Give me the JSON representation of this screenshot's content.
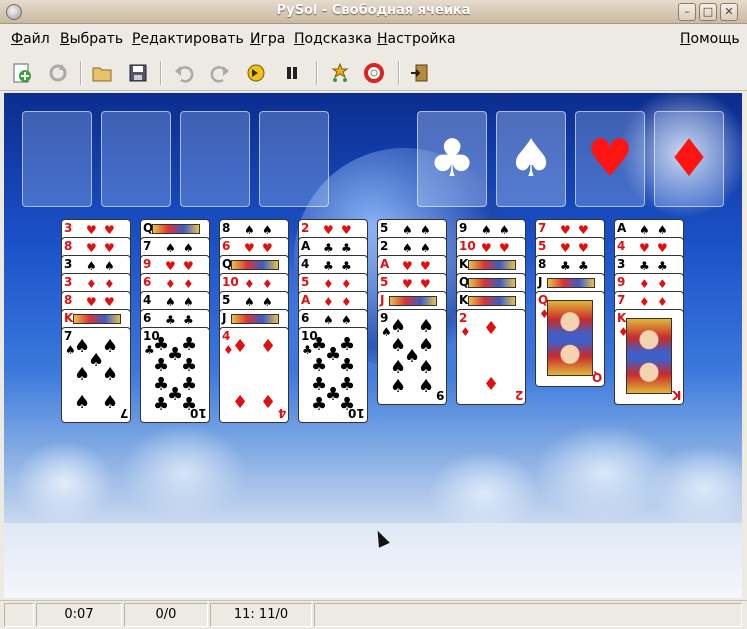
{
  "window": {
    "title": "PySol - Свободная ячейка"
  },
  "menu": [
    {
      "first": "Ф",
      "rest": "айл"
    },
    {
      "first": "В",
      "rest": "ыбрать"
    },
    {
      "first": "Р",
      "rest": "едактировать"
    },
    {
      "first": "И",
      "rest": "гра"
    },
    {
      "first": "П",
      "rest": "одсказка"
    },
    {
      "first": "Н",
      "rest": "астройка"
    }
  ],
  "help_menu": {
    "first": "П",
    "rest": "омощь"
  },
  "toolbar_icons": [
    "new-game-icon",
    "restart-icon",
    "open-icon",
    "save-icon",
    "undo-icon",
    "redo-icon",
    "autodrop-icon",
    "pause-icon",
    "statistics-icon",
    "rules-icon",
    "quit-icon"
  ],
  "status": {
    "time": "0:07",
    "moves": "0/0",
    "cards": "11: 11/0",
    "message": ""
  },
  "game": {
    "free_cells": 4,
    "foundations": [
      {
        "suit": "♣",
        "color": "white"
      },
      {
        "suit": "♠",
        "color": "white"
      },
      {
        "suit": "♥",
        "color": "red"
      },
      {
        "suit": "♦",
        "color": "red"
      }
    ],
    "tableau": [
      [
        {
          "r": "3",
          "s": "♥"
        },
        {
          "r": "8",
          "s": "♥"
        },
        {
          "r": "3",
          "s": "♠"
        },
        {
          "r": "3",
          "s": "♦"
        },
        {
          "r": "8",
          "s": "♥"
        },
        {
          "r": "K",
          "s": "♥"
        },
        {
          "r": "7",
          "s": "♠"
        }
      ],
      [
        {
          "r": "Q",
          "s": "♠"
        },
        {
          "r": "7",
          "s": "♠"
        },
        {
          "r": "9",
          "s": "♥"
        },
        {
          "r": "6",
          "s": "♦"
        },
        {
          "r": "4",
          "s": "♠"
        },
        {
          "r": "6",
          "s": "♣"
        },
        {
          "r": "10",
          "s": "♣"
        }
      ],
      [
        {
          "r": "8",
          "s": "♠"
        },
        {
          "r": "6",
          "s": "♥"
        },
        {
          "r": "Q",
          "s": "♣"
        },
        {
          "r": "10",
          "s": "♦"
        },
        {
          "r": "5",
          "s": "♠"
        },
        {
          "r": "J",
          "s": "♣"
        },
        {
          "r": "4",
          "s": "♦"
        }
      ],
      [
        {
          "r": "2",
          "s": "♥"
        },
        {
          "r": "A",
          "s": "♣"
        },
        {
          "r": "4",
          "s": "♣"
        },
        {
          "r": "5",
          "s": "♦"
        },
        {
          "r": "A",
          "s": "♦"
        },
        {
          "r": "6",
          "s": "♠"
        },
        {
          "r": "10",
          "s": "♣"
        }
      ],
      [
        {
          "r": "5",
          "s": "♠"
        },
        {
          "r": "2",
          "s": "♠"
        },
        {
          "r": "A",
          "s": "♥"
        },
        {
          "r": "5",
          "s": "♥"
        },
        {
          "r": "J",
          "s": "♦"
        },
        {
          "r": "9",
          "s": "♠"
        }
      ],
      [
        {
          "r": "9",
          "s": "♠"
        },
        {
          "r": "10",
          "s": "♥"
        },
        {
          "r": "K",
          "s": "♣"
        },
        {
          "r": "Q",
          "s": "♣"
        },
        {
          "r": "K",
          "s": "♠"
        },
        {
          "r": "2",
          "s": "♦"
        }
      ],
      [
        {
          "r": "7",
          "s": "♥"
        },
        {
          "r": "5",
          "s": "♥"
        },
        {
          "r": "8",
          "s": "♣"
        },
        {
          "r": "J",
          "s": "♠"
        },
        {
          "r": "Q",
          "s": "♦"
        }
      ],
      [
        {
          "r": "A",
          "s": "♠"
        },
        {
          "r": "4",
          "s": "♥"
        },
        {
          "r": "3",
          "s": "♣"
        },
        {
          "r": "9",
          "s": "♦"
        },
        {
          "r": "7",
          "s": "♦"
        },
        {
          "r": "K",
          "s": "♦"
        }
      ]
    ]
  }
}
